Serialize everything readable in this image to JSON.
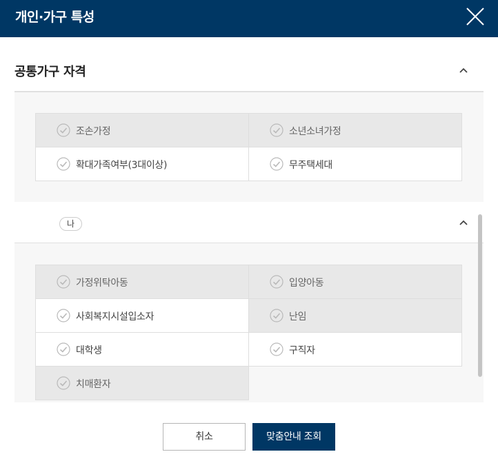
{
  "dialog": {
    "title": "개인·가구 특성",
    "close_icon": "close-icon"
  },
  "sections": [
    {
      "title": "공통가구 자격",
      "collapse_icon": "chevron-up-icon",
      "items": [
        {
          "label": "조손가정",
          "disabled": true
        },
        {
          "label": "소년소녀가정",
          "disabled": true
        },
        {
          "label": "확대가족여부(3대이상)",
          "disabled": false
        },
        {
          "label": "무주택세대",
          "disabled": false
        }
      ]
    },
    {
      "badge": "나",
      "collapse_icon": "chevron-up-icon",
      "items": [
        {
          "label": "가정위탁아동",
          "disabled": true
        },
        {
          "label": "입양아동",
          "disabled": true
        },
        {
          "label": "사회복지시설입소자",
          "disabled": false
        },
        {
          "label": "난임",
          "disabled": true
        },
        {
          "label": "대학생",
          "disabled": false
        },
        {
          "label": "구직자",
          "disabled": false
        },
        {
          "label": "치매환자",
          "disabled": true
        }
      ]
    }
  ],
  "footer": {
    "cancel_label": "취소",
    "search_label": "맞춤안내 조회"
  },
  "colors": {
    "header_bg": "#003764",
    "panel_bg": "#f7f7f7",
    "disabled_cell": "#e8e8e8",
    "primary_button": "#003764"
  }
}
